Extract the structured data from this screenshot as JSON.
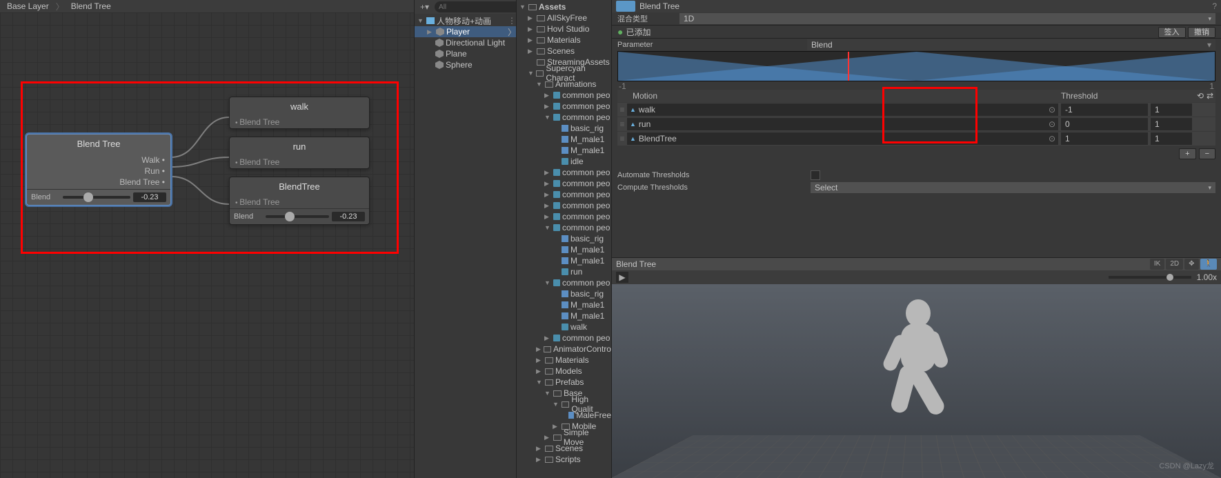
{
  "breadcrumb": [
    "Base Layer",
    "Blend Tree"
  ],
  "nodes": {
    "blendtree_main": {
      "title": "Blend Tree",
      "ports": [
        "Walk",
        "Run",
        "Blend Tree"
      ],
      "param_label": "Blend",
      "param_value": "-0.23"
    },
    "walk": {
      "title": "walk",
      "sub": "Blend Tree"
    },
    "run": {
      "title": "run",
      "sub": "Blend Tree"
    },
    "blendtree_child": {
      "title": "BlendTree",
      "sub": "Blend Tree",
      "param_label": "Blend",
      "param_value": "-0.23"
    }
  },
  "hierarchy": {
    "search_placeholder": "All",
    "scene": "人物移动+动画",
    "items": [
      "Player",
      "Directional Light",
      "Plane",
      "Sphere"
    ]
  },
  "project": {
    "root": "Assets",
    "items": [
      {
        "name": "AllSkyFree",
        "ind": 1,
        "fold": "▶",
        "icon": "folder"
      },
      {
        "name": "Hovl Studio",
        "ind": 1,
        "fold": "▶",
        "icon": "folder"
      },
      {
        "name": "Materials",
        "ind": 1,
        "fold": "▶",
        "icon": "folder"
      },
      {
        "name": "Scenes",
        "ind": 1,
        "fold": "▶",
        "icon": "folder"
      },
      {
        "name": "StreamingAssets",
        "ind": 1,
        "fold": "",
        "icon": "folder"
      },
      {
        "name": "Supercyan Charact",
        "ind": 1,
        "fold": "▼",
        "icon": "folder"
      },
      {
        "name": "Animations",
        "ind": 2,
        "fold": "▼",
        "icon": "folder"
      },
      {
        "name": "common peo",
        "ind": 3,
        "fold": "▶",
        "icon": "anim"
      },
      {
        "name": "common peo",
        "ind": 3,
        "fold": "▶",
        "icon": "anim"
      },
      {
        "name": "common peo",
        "ind": 3,
        "fold": "▼",
        "icon": "anim"
      },
      {
        "name": "basic_rig",
        "ind": 4,
        "fold": "",
        "icon": "prefab"
      },
      {
        "name": "M_male1",
        "ind": 4,
        "fold": "",
        "icon": "prefab"
      },
      {
        "name": "M_male1",
        "ind": 4,
        "fold": "",
        "icon": "prefab"
      },
      {
        "name": "idle",
        "ind": 4,
        "fold": "",
        "icon": "anim"
      },
      {
        "name": "common peo",
        "ind": 3,
        "fold": "▶",
        "icon": "anim"
      },
      {
        "name": "common peo",
        "ind": 3,
        "fold": "▶",
        "icon": "anim"
      },
      {
        "name": "common peo",
        "ind": 3,
        "fold": "▶",
        "icon": "anim"
      },
      {
        "name": "common peo",
        "ind": 3,
        "fold": "▶",
        "icon": "anim"
      },
      {
        "name": "common peo",
        "ind": 3,
        "fold": "▶",
        "icon": "anim"
      },
      {
        "name": "common peo",
        "ind": 3,
        "fold": "▼",
        "icon": "anim"
      },
      {
        "name": "basic_rig",
        "ind": 4,
        "fold": "",
        "icon": "prefab"
      },
      {
        "name": "M_male1",
        "ind": 4,
        "fold": "",
        "icon": "prefab"
      },
      {
        "name": "M_male1",
        "ind": 4,
        "fold": "",
        "icon": "prefab"
      },
      {
        "name": "run",
        "ind": 4,
        "fold": "",
        "icon": "anim"
      },
      {
        "name": "common peo",
        "ind": 3,
        "fold": "▼",
        "icon": "anim"
      },
      {
        "name": "basic_rig",
        "ind": 4,
        "fold": "",
        "icon": "prefab"
      },
      {
        "name": "M_male1",
        "ind": 4,
        "fold": "",
        "icon": "prefab"
      },
      {
        "name": "M_male1",
        "ind": 4,
        "fold": "",
        "icon": "prefab"
      },
      {
        "name": "walk",
        "ind": 4,
        "fold": "",
        "icon": "anim"
      },
      {
        "name": "common peo",
        "ind": 3,
        "fold": "▶",
        "icon": "anim"
      },
      {
        "name": "AnimatorContro",
        "ind": 2,
        "fold": "▶",
        "icon": "folder"
      },
      {
        "name": "Materials",
        "ind": 2,
        "fold": "▶",
        "icon": "folder"
      },
      {
        "name": "Models",
        "ind": 2,
        "fold": "▶",
        "icon": "folder"
      },
      {
        "name": "Prefabs",
        "ind": 2,
        "fold": "▼",
        "icon": "folder"
      },
      {
        "name": "Base",
        "ind": 3,
        "fold": "▼",
        "icon": "folder"
      },
      {
        "name": "High Qualit",
        "ind": 4,
        "fold": "▼",
        "icon": "folder"
      },
      {
        "name": "MaleFree",
        "ind": 5,
        "fold": "",
        "icon": "prefab"
      },
      {
        "name": "Mobile",
        "ind": 4,
        "fold": "▶",
        "icon": "folder"
      },
      {
        "name": "Simple Move",
        "ind": 3,
        "fold": "▶",
        "icon": "folder"
      },
      {
        "name": "Scenes",
        "ind": 2,
        "fold": "▶",
        "icon": "folder"
      },
      {
        "name": "Scripts",
        "ind": 2,
        "fold": "▶",
        "icon": "folder"
      }
    ]
  },
  "inspector": {
    "title": "Blend Tree",
    "blend_type_label": "混合类型",
    "blend_type_value": "1D",
    "added": "已添加",
    "btn_signin": "签入",
    "btn_undo": "撤销",
    "param_label": "Parameter",
    "param_value": "Blend",
    "axis_min": "-1",
    "axis_max": "1",
    "motion_header": "Motion",
    "threshold_header": "Threshold",
    "motions": [
      {
        "name": "walk",
        "thr": "-1",
        "speed": "1",
        "obj": true
      },
      {
        "name": "run",
        "thr": "0",
        "speed": "1",
        "obj": true
      },
      {
        "name": "BlendTree",
        "thr": "1",
        "speed": "1",
        "obj": true
      }
    ],
    "automate_label": "Automate Thresholds",
    "compute_label": "Compute Thresholds",
    "compute_value": "Select"
  },
  "preview": {
    "title": "Blend Tree",
    "speed": "1.00x",
    "btns": [
      "IK",
      "2D"
    ]
  },
  "watermark": "CSDN @Lazy龙"
}
